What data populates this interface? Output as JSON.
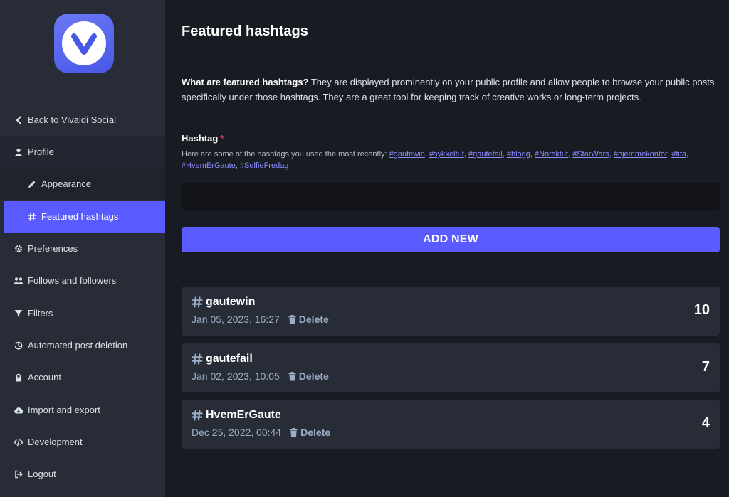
{
  "sidebar": {
    "items": [
      {
        "label": "Back to Vivaldi Social",
        "icon": "chevron-left-icon"
      },
      {
        "label": "Profile",
        "icon": "user-icon"
      },
      {
        "label": "Appearance",
        "icon": "pencil-icon"
      },
      {
        "label": "Featured hashtags",
        "icon": "hashtag-icon"
      },
      {
        "label": "Preferences",
        "icon": "gear-icon"
      },
      {
        "label": "Follows and followers",
        "icon": "users-icon"
      },
      {
        "label": "Filters",
        "icon": "filter-icon"
      },
      {
        "label": "Automated post deletion",
        "icon": "history-icon"
      },
      {
        "label": "Account",
        "icon": "lock-icon"
      },
      {
        "label": "Import and export",
        "icon": "cloud-icon"
      },
      {
        "label": "Development",
        "icon": "code-icon"
      },
      {
        "label": "Logout",
        "icon": "sign-out-icon"
      }
    ]
  },
  "main": {
    "title": "Featured hashtags",
    "intro_bold": "What are featured hashtags?",
    "intro_text": " They are displayed prominently on your public profile and allow people to browse your public posts specifically under those hashtags. They are a great tool for keeping track of creative works or long-term projects.",
    "field_label": "Hashtag",
    "required_mark": "*",
    "hint_text": "Here are some of the hashtags you used the most recently: ",
    "suggestions": [
      "#gautewin",
      "#sykkeltut",
      "#gautefail",
      "#blogg",
      "#Norsktut",
      "#StarWars",
      "#hjemmekontor",
      "#fifa",
      "#HvemErGaute",
      "#SelfieFredag"
    ],
    "input_value": "",
    "add_button": "ADD NEW",
    "delete_label": "Delete",
    "hashtags": [
      {
        "name": "gautewin",
        "date": "Jan 05, 2023, 16:27",
        "count": "10"
      },
      {
        "name": "gautefail",
        "date": "Jan 02, 2023, 10:05",
        "count": "7"
      },
      {
        "name": "HvemErGaute",
        "date": "Dec 25, 2022, 00:44",
        "count": "4"
      }
    ]
  },
  "colors": {
    "accent": "#595aff",
    "sidebar_bg": "#282c37",
    "main_bg": "#191b22",
    "link": "#8c8dff",
    "required": "#df405a"
  }
}
